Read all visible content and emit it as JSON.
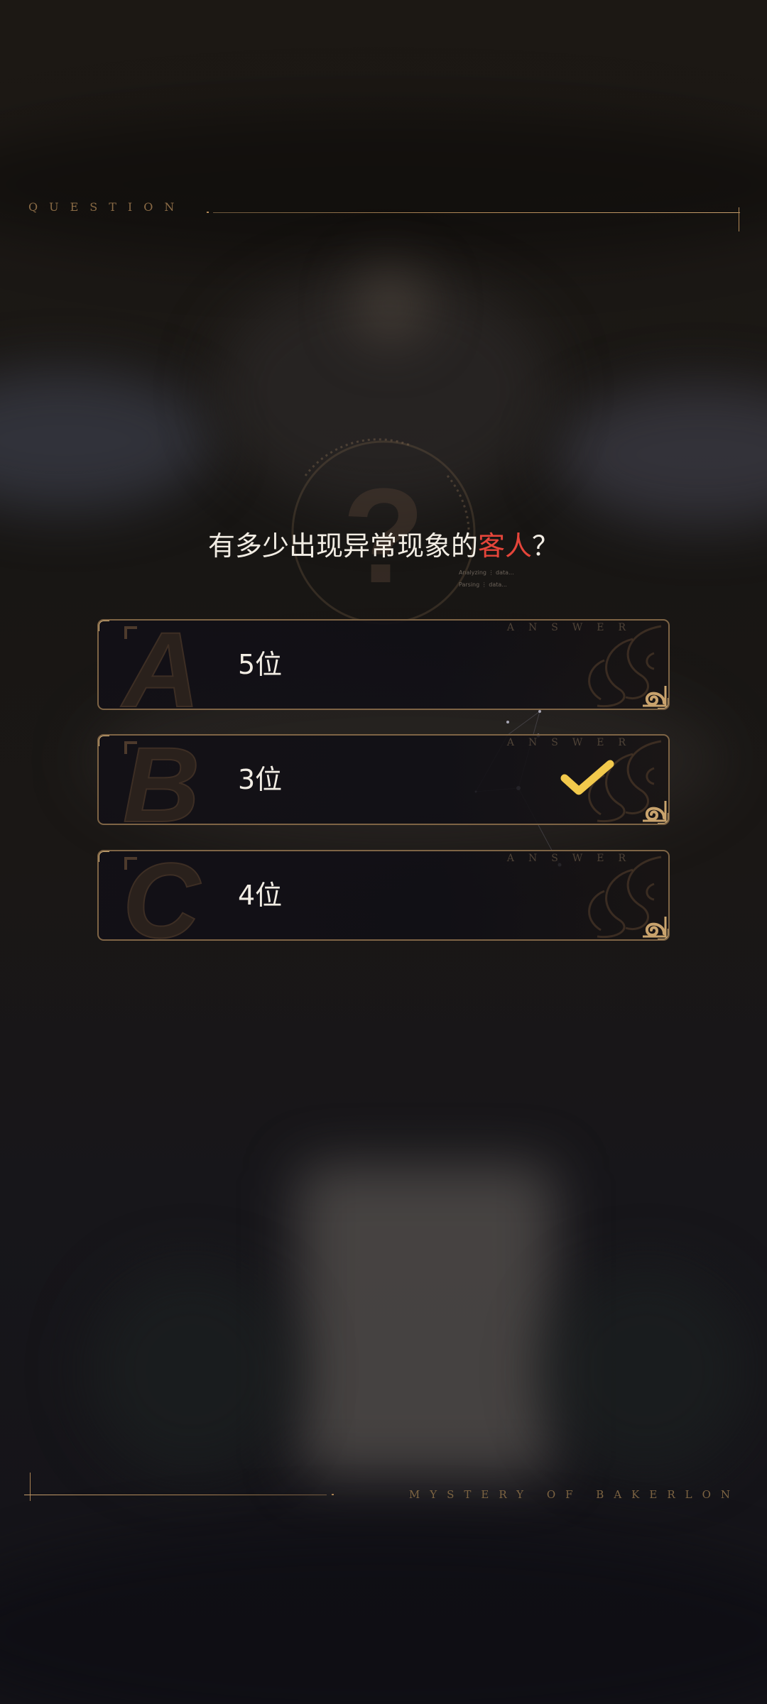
{
  "header": {
    "label": "QUESTION"
  },
  "emblem": {
    "status_line_1": "Analyzing ⋮ data...",
    "status_line_2": "Parsing ⋮ data..."
  },
  "question": {
    "text_before": "有多少出现异常现象的",
    "highlight": "客人",
    "text_after": "？",
    "highlight_color": "#e5453a"
  },
  "answers": [
    {
      "letter": "A",
      "tag": "ANSWER",
      "text": "5位",
      "selected": false
    },
    {
      "letter": "B",
      "tag": "ANSWER",
      "text": "3位",
      "selected": true
    },
    {
      "letter": "C",
      "tag": "ANSWER",
      "text": "4位",
      "selected": false
    }
  ],
  "footer": {
    "label": "MYSTERY OF BAKERLON"
  },
  "colors": {
    "gold": "#c49c6a",
    "check": "#f2c94c",
    "text": "#f2ede4"
  }
}
